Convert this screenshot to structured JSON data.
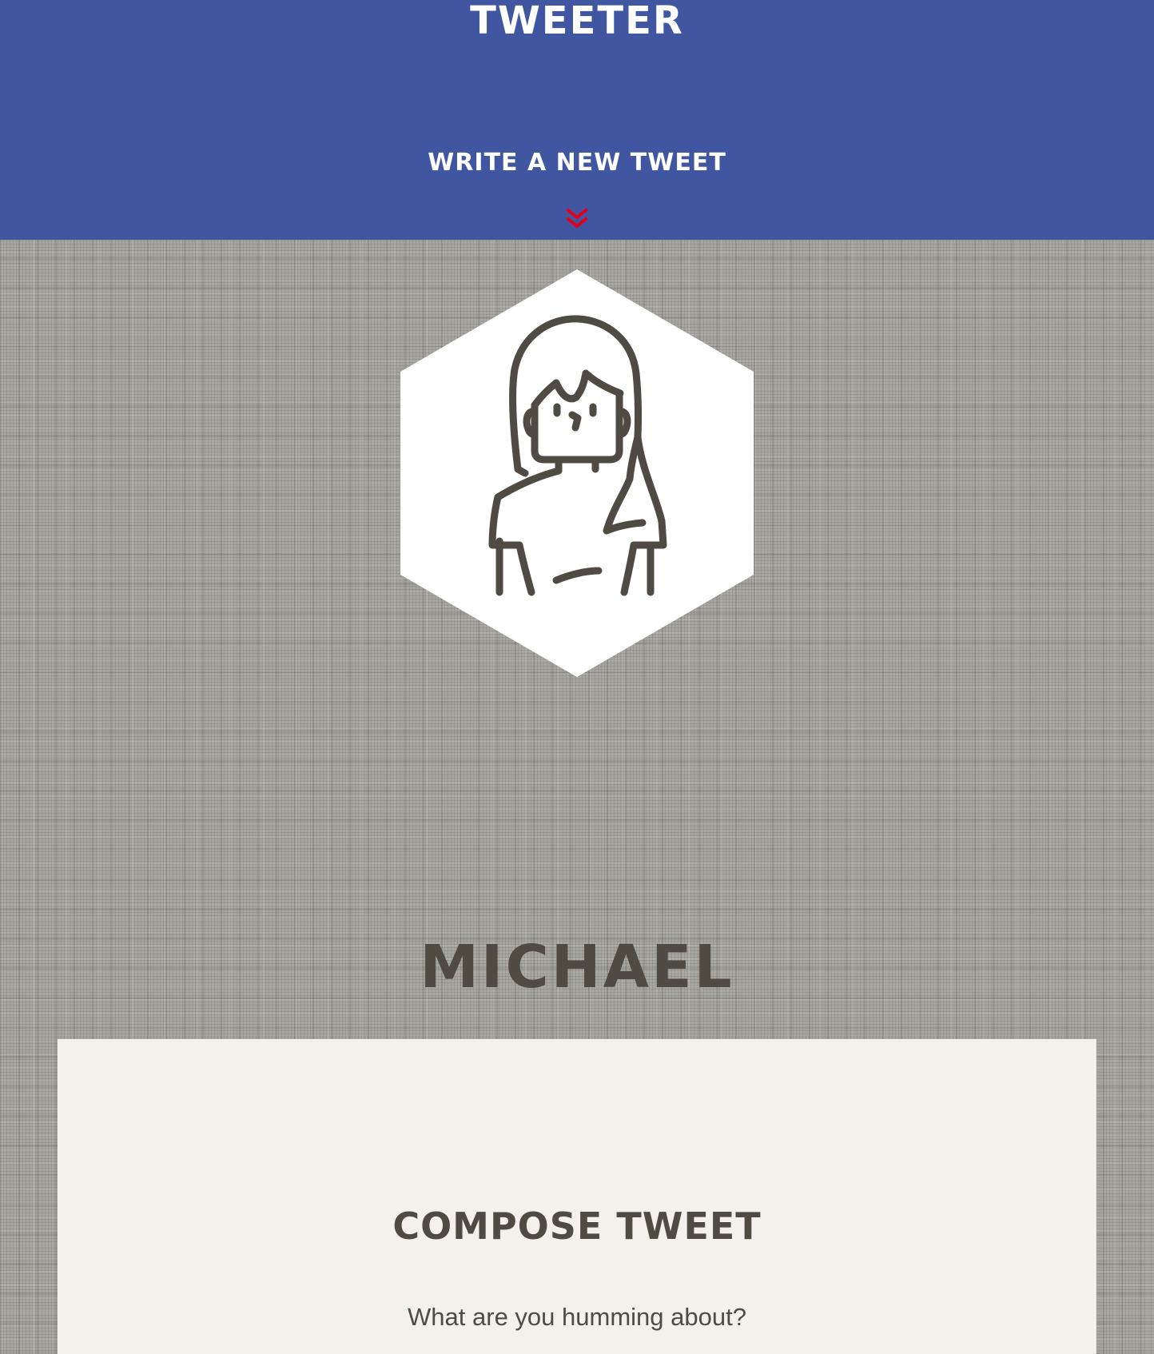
{
  "colors": {
    "nav_background": "#4056a1",
    "accent_arrow": "#e0001b",
    "heading_text": "#4f4b43",
    "panel_background": "#f4f1ec",
    "page_background": "#a8a6a1"
  },
  "nav": {
    "brand": "TWEETER",
    "cta_label": "WRITE A NEW TWEET",
    "cta_icon": "double-chevron-down-icon"
  },
  "profile": {
    "avatar_icon": "user-avatar-icon",
    "name": "MICHAEL"
  },
  "compose": {
    "title": "COMPOSE TWEET",
    "prompt": "What are you humming about?"
  }
}
